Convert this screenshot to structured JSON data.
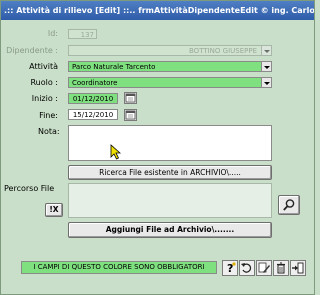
{
  "window": {
    "title": ".:: Attività di rilievo [Edit] ::..  frmAttivitàDipendenteEdit © ing. Carlo Scaroni"
  },
  "form": {
    "id_label": "Id:",
    "id_value": "137",
    "dipendente_label": "Dipendente :",
    "dipendente_value": "BOTTINO  GIUSEPPE",
    "attivita_label": "Attività",
    "attivita_value": "Parco Naturale Tarcento",
    "ruolo_label": "Ruolo :",
    "ruolo_value": "Coordinatore",
    "inizio_label": "Inizio :",
    "inizio_value": "01/12/2010",
    "fine_label": "Fine:",
    "fine_value": "15/12/2010",
    "nota_label": "Nota:",
    "nota_value": "",
    "percorso_label": "Percorso File",
    "percorso_value": "",
    "clear_button_label": "!X"
  },
  "buttons": {
    "ricerca_label": "Ricerca File esistente in ARCHIVIO\\.....",
    "aggiungi_label": "Aggiungi File ad Archivio\\......."
  },
  "footer": {
    "required_hint": "I CAMPI DI QUESTO COLORE SONO OBBLIGATORI"
  },
  "colors": {
    "required_field": "#7fe07f",
    "window_bg": "#c9dfc9",
    "title_bg": "#2f5ca8"
  },
  "icons": [
    "calendar-icon",
    "search-icon",
    "help-icon",
    "undo-icon",
    "edit-icon",
    "delete-icon",
    "exit-icon",
    "mouse-cursor-icon"
  ]
}
